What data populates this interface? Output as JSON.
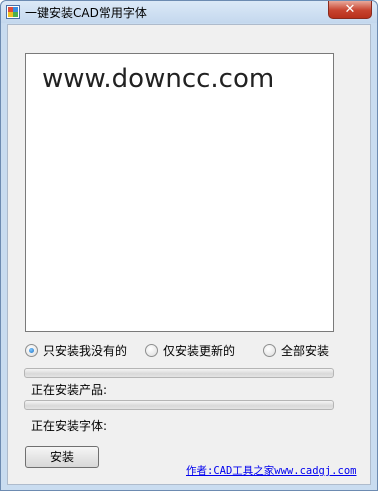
{
  "window": {
    "title": "一键安装CAD常用字体",
    "close_glyph": "✕"
  },
  "textbox": {
    "text": "www.downcc.com"
  },
  "options": [
    {
      "label": "只安装我没有的",
      "checked": true
    },
    {
      "label": "仅安装更新的",
      "checked": false
    },
    {
      "label": "全部安装",
      "checked": false
    }
  ],
  "progress": {
    "product_label": "正在安装产品:",
    "font_label": "正在安装字体:",
    "product_value": 0,
    "font_value": 0
  },
  "install_button": {
    "label": "安装"
  },
  "author_link": {
    "text": "作者:CAD工具之家www.cadgj.com"
  },
  "colors": {
    "link": "#0000ee",
    "close": "#c7432e"
  }
}
